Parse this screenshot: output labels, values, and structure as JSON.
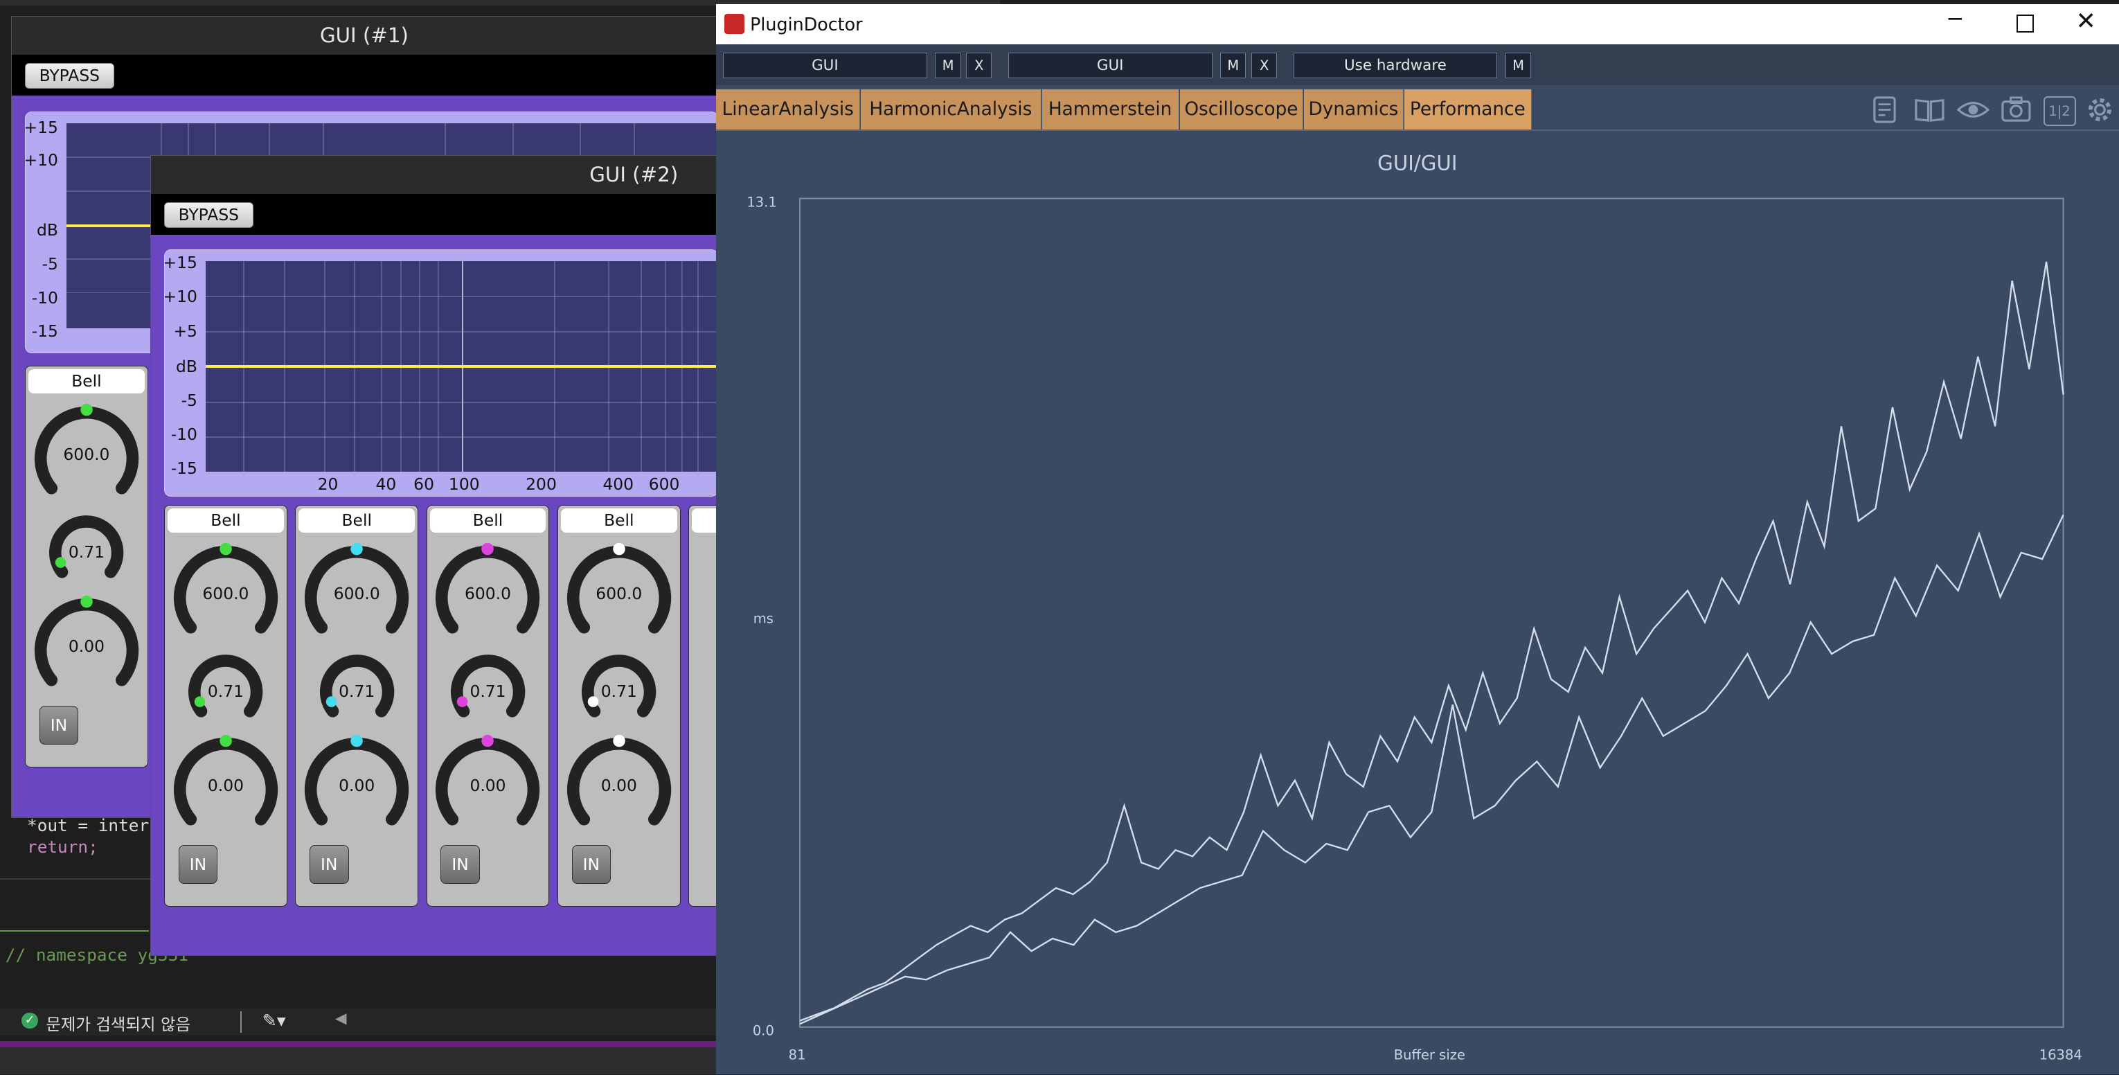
{
  "ide": {
    "code_line_1": "*out = inter",
    "code_line_2": "return;",
    "comment_line": "// namespace yg331",
    "status_text": "문제가 검색되지 않음"
  },
  "gui1": {
    "title": "GUI (#1)",
    "bypass_label": "BYPASS",
    "y_labels": [
      "+15",
      "+10",
      "dB",
      "-5",
      "-10",
      "-15"
    ],
    "band": {
      "type": "Bell",
      "freq": "600.0",
      "q": "0.71",
      "gain": "0.00",
      "in_label": "IN",
      "color": "#44dd44"
    }
  },
  "gui2": {
    "title": "GUI (#2)",
    "bypass_label": "BYPASS",
    "y_labels": [
      "+15",
      "+10",
      "+5",
      "dB",
      "-5",
      "-10",
      "-15"
    ],
    "x_labels": [
      "20",
      "40",
      "60",
      "100",
      "200",
      "400",
      "600"
    ],
    "bands": [
      {
        "type": "Bell",
        "freq": "600.0",
        "q": "0.71",
        "gain": "0.00",
        "in_label": "IN",
        "color": "#44dd44"
      },
      {
        "type": "Bell",
        "freq": "600.0",
        "q": "0.71",
        "gain": "0.00",
        "in_label": "IN",
        "color": "#44ddee"
      },
      {
        "type": "Bell",
        "freq": "600.0",
        "q": "0.71",
        "gain": "0.00",
        "in_label": "IN",
        "color": "#dd44dd"
      },
      {
        "type": "Bell",
        "freq": "600.0",
        "q": "0.71",
        "gain": "0.00",
        "in_label": "IN",
        "color": "#ffffff"
      }
    ]
  },
  "plugindoctor": {
    "window_title": "PluginDoctor",
    "controls": {
      "plugin_a": "GUI",
      "plugin_b": "GUI",
      "hardware": "Use hardware",
      "m_label": "M",
      "x_label": "X"
    },
    "tabs": [
      "LinearAnalysis",
      "HarmonicAnalysis",
      "Hammerstein",
      "Oscilloscope",
      "Dynamics",
      "Performance"
    ],
    "active_tab": "Performance",
    "page_indicator": "1|2"
  },
  "chart_data": {
    "type": "line",
    "title": "GUI/GUI",
    "xlabel": "Buffer size",
    "ylabel": "ms",
    "x_range_labels": [
      "81",
      "16384"
    ],
    "y_range_labels": [
      "0.0",
      "13.1"
    ],
    "xlim": [
      81,
      16384
    ],
    "ylim": [
      0.0,
      13.1
    ],
    "series": [
      {
        "values": [
          0.1,
          0.2,
          0.3,
          0.45,
          0.6,
          0.7,
          0.9,
          1.1,
          1.3,
          1.45,
          1.6,
          1.5,
          1.7,
          1.8,
          2.0,
          2.2,
          2.1,
          2.3,
          2.6,
          3.5,
          2.6,
          2.5,
          2.8,
          2.7,
          3.0,
          2.8,
          3.4,
          4.3,
          3.5,
          3.9,
          3.3,
          4.5,
          4.0,
          3.8,
          4.6,
          4.2,
          4.9,
          4.5,
          5.4,
          4.7,
          5.6,
          4.8,
          5.2,
          6.3,
          5.5,
          5.3,
          6.0,
          5.6,
          6.8,
          5.9,
          6.3,
          6.6,
          6.9,
          6.4,
          7.1,
          6.7,
          7.4,
          8.0,
          7.0,
          8.3,
          7.6,
          9.5,
          8.0,
          8.2,
          9.8,
          8.5,
          9.1,
          10.2,
          9.3,
          10.6,
          9.5,
          11.8,
          10.4,
          12.1,
          10.0
        ]
      },
      {
        "values": [
          0.05,
          0.2,
          0.35,
          0.5,
          0.65,
          0.8,
          0.75,
          0.9,
          1.0,
          1.1,
          1.5,
          1.2,
          1.4,
          1.3,
          1.7,
          1.5,
          1.6,
          1.8,
          2.0,
          2.2,
          2.3,
          2.4,
          3.1,
          2.8,
          2.6,
          2.9,
          2.8,
          3.4,
          3.5,
          3.0,
          3.4,
          5.1,
          3.3,
          3.5,
          3.9,
          4.2,
          3.8,
          4.9,
          4.1,
          4.6,
          5.2,
          4.6,
          4.8,
          5.0,
          5.4,
          5.9,
          5.2,
          5.6,
          6.4,
          5.9,
          6.1,
          6.2,
          7.1,
          6.5,
          7.3,
          6.9,
          7.8,
          6.8,
          7.5,
          7.4,
          8.1
        ]
      }
    ]
  }
}
